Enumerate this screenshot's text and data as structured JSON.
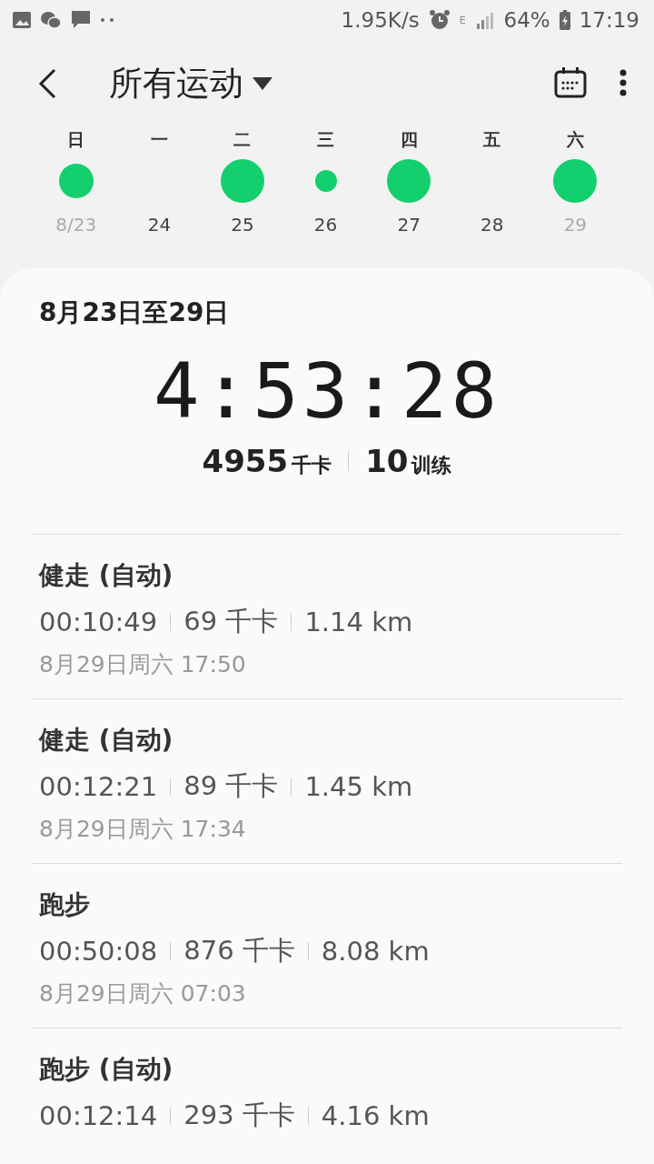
{
  "status_bar": {
    "speed": "1.95K/s",
    "network": "E",
    "battery": "64%",
    "time": "17:19"
  },
  "header": {
    "title": "所有运动"
  },
  "week": [
    {
      "kind": "medium",
      "weekday": "日",
      "date": "8/23",
      "muted": true
    },
    {
      "kind": "empty",
      "weekday": "一",
      "date": "24",
      "muted": false
    },
    {
      "kind": "large",
      "weekday": "二",
      "date": "25",
      "muted": false
    },
    {
      "kind": "small",
      "weekday": "三",
      "date": "26",
      "muted": false
    },
    {
      "kind": "large",
      "weekday": "四",
      "date": "27",
      "muted": false
    },
    {
      "kind": "empty",
      "weekday": "五",
      "date": "28",
      "muted": false
    },
    {
      "kind": "large",
      "weekday": "六",
      "date": "29",
      "muted": true
    }
  ],
  "summary": {
    "range": "8月23日至29日",
    "duration": "4:53:28",
    "calories": "4955",
    "calories_unit": "千卡",
    "workouts": "10",
    "workouts_unit": "训练"
  },
  "activities": [
    {
      "name": "健走 (自动)",
      "duration": "00:10:49",
      "calories": "69 千卡",
      "distance": "1.14 km",
      "date": "8月29日周六 17:50"
    },
    {
      "name": "健走 (自动)",
      "duration": "00:12:21",
      "calories": "89 千卡",
      "distance": "1.45 km",
      "date": "8月29日周六 17:34"
    },
    {
      "name": "跑步",
      "duration": "00:50:08",
      "calories": "876 千卡",
      "distance": "8.08 km",
      "date": "8月29日周六 07:03"
    },
    {
      "name": "跑步 (自动)",
      "duration": "00:12:14",
      "calories": "293 千卡",
      "distance": "4.16 km"
    }
  ]
}
